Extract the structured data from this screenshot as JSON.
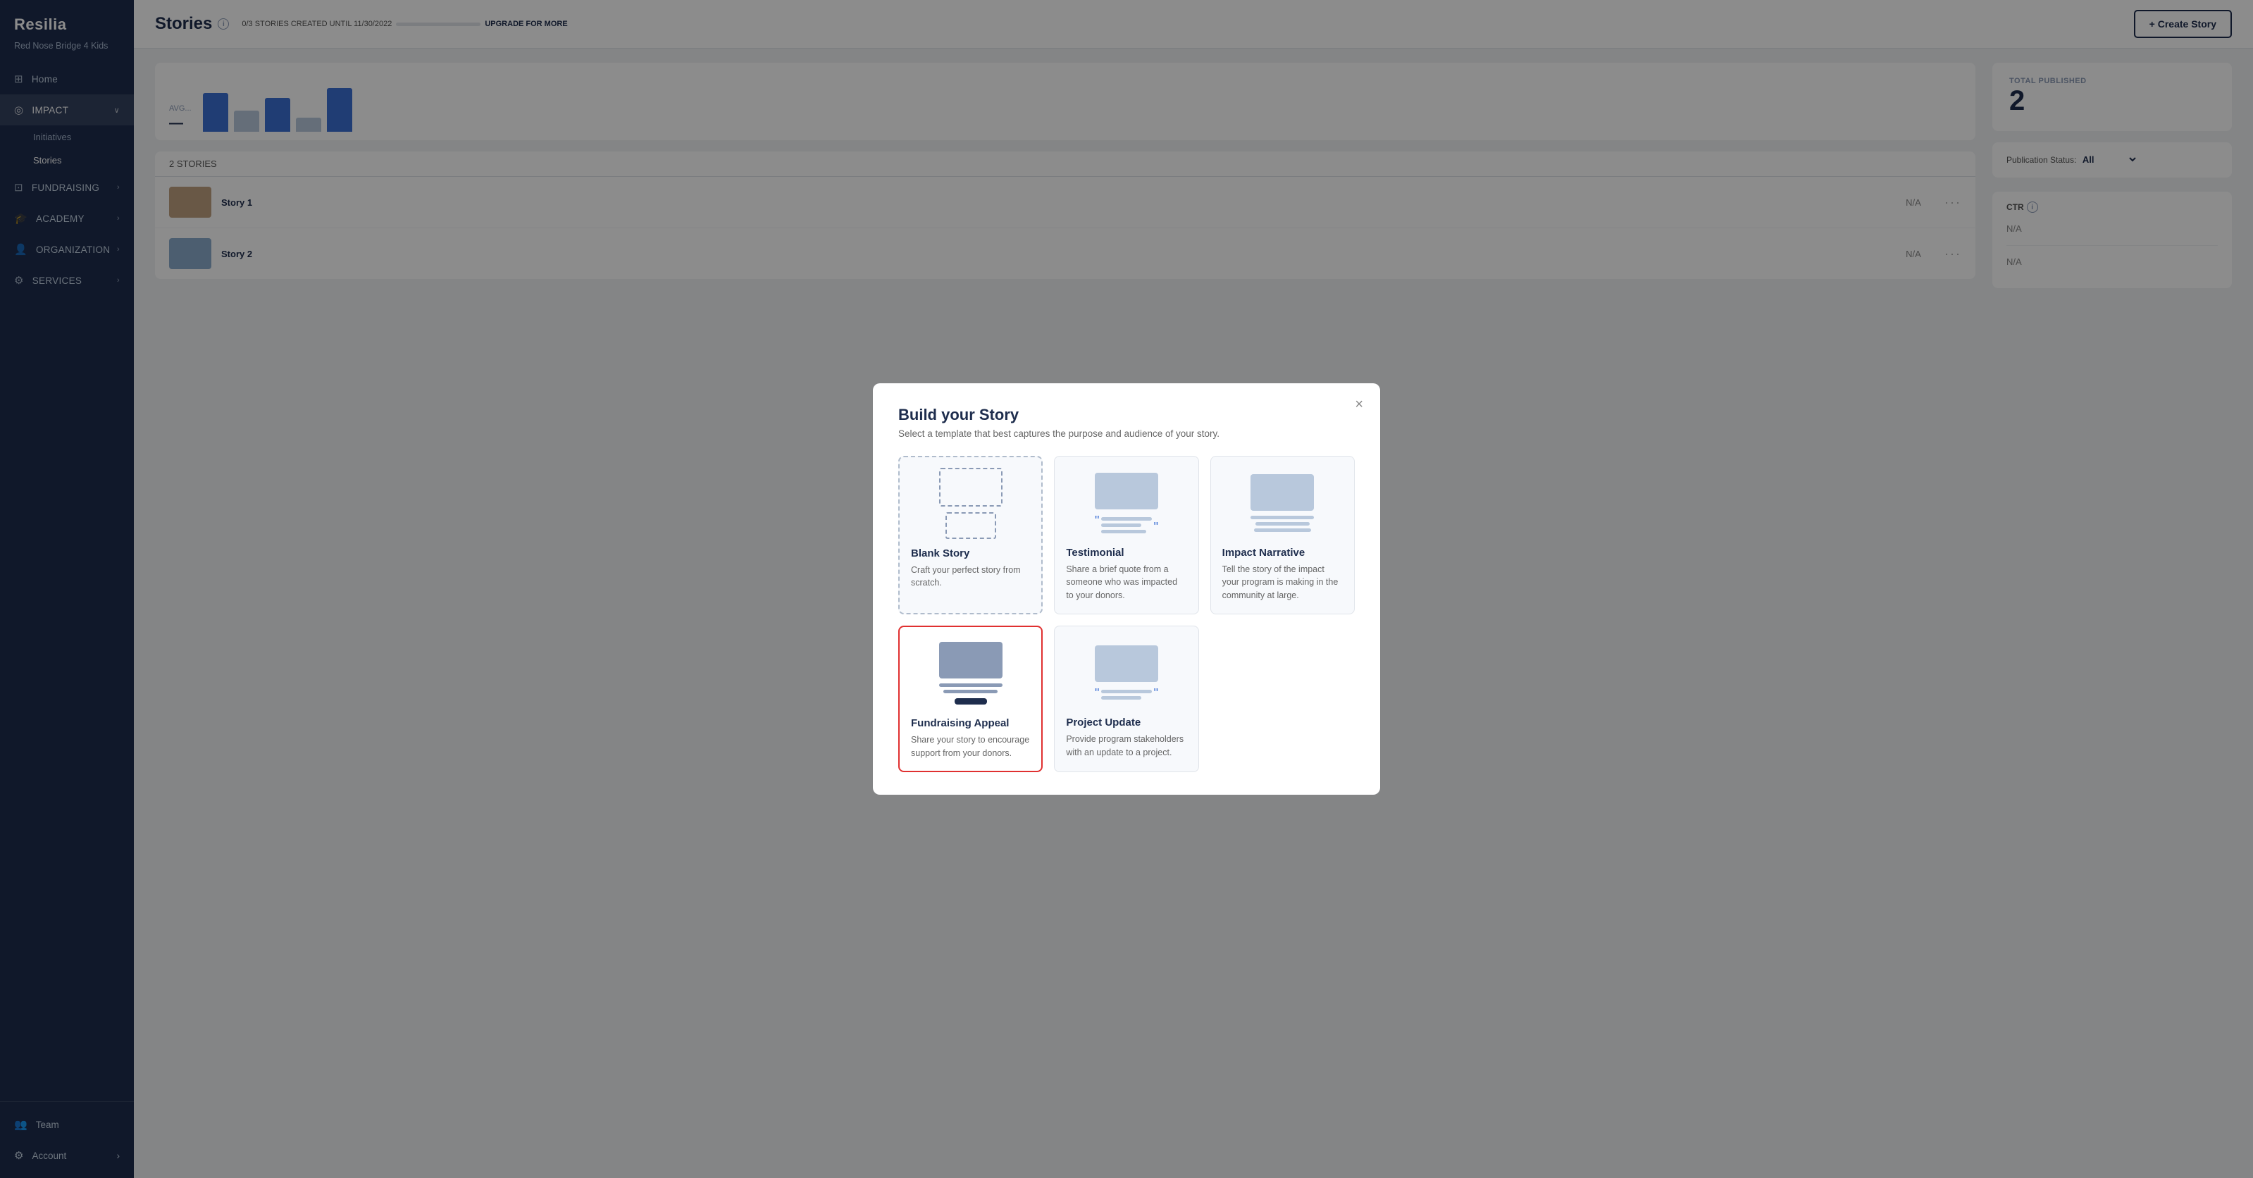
{
  "app": {
    "name": "Resilia",
    "org_name": "Red Nose Bridge 4 Kids"
  },
  "sidebar": {
    "nav_items": [
      {
        "id": "home",
        "label": "Home",
        "icon": "⊞",
        "has_chevron": false
      },
      {
        "id": "impact",
        "label": "IMPACT",
        "icon": "◎",
        "has_chevron": true,
        "active": true
      },
      {
        "id": "fundraising",
        "label": "FUNDRAISING",
        "icon": "⊡",
        "has_chevron": true
      },
      {
        "id": "academy",
        "label": "ACADEMY",
        "icon": "🎓",
        "has_chevron": true
      },
      {
        "id": "organization",
        "label": "ORGANIZATION",
        "icon": "👤",
        "has_chevron": true
      },
      {
        "id": "services",
        "label": "SERVICES",
        "icon": "⚙",
        "has_chevron": true
      }
    ],
    "impact_subitems": [
      {
        "id": "initiatives",
        "label": "Initiatives"
      },
      {
        "id": "stories",
        "label": "Stories",
        "active": true
      }
    ],
    "bottom_items": [
      {
        "id": "team",
        "label": "Team",
        "icon": "👥"
      },
      {
        "id": "account",
        "label": "Account",
        "icon": "⚙",
        "has_chevron": true
      }
    ]
  },
  "header": {
    "title": "Stories",
    "stories_badge": "0/3 STORIES CREATED UNTIL 11/30/2022",
    "upgrade_label": "UPGRADE FOR MORE",
    "create_button": "+ Create Story"
  },
  "stats": {
    "total_published_label": "TOTAL PUBLISHED",
    "total_published_value": "2"
  },
  "filters": {
    "publication_status_label": "Publication Status:",
    "publication_status_value": "All"
  },
  "table": {
    "count_label": "2 STORIES",
    "columns": [
      "",
      "",
      "CTR"
    ],
    "rows": [
      {
        "id": 1,
        "title": "",
        "ctr": "N/A"
      },
      {
        "id": 2,
        "title": "",
        "ctr": "N/A"
      }
    ]
  },
  "modal": {
    "title": "Build your Story",
    "subtitle": "Select a template that best captures the purpose and audience of your story.",
    "close_label": "×",
    "templates": [
      {
        "id": "blank",
        "name": "Blank Story",
        "desc": "Craft your perfect story from scratch.",
        "style": "blank",
        "selected": false
      },
      {
        "id": "testimonial",
        "name": "Testimonial",
        "desc": "Share a brief quote from a someone who was impacted to your donors.",
        "style": "testimonial",
        "selected": false
      },
      {
        "id": "impact",
        "name": "Impact Narrative",
        "desc": "Tell the story of the impact your program is making in the community at large.",
        "style": "impact",
        "selected": false
      },
      {
        "id": "fundraising",
        "name": "Fundraising Appeal",
        "desc": "Share your story to encourage support from your donors.",
        "style": "fundraising",
        "selected": true
      },
      {
        "id": "project",
        "name": "Project Update",
        "desc": "Provide program stakeholders with an update to a project.",
        "style": "project",
        "selected": false
      }
    ]
  }
}
